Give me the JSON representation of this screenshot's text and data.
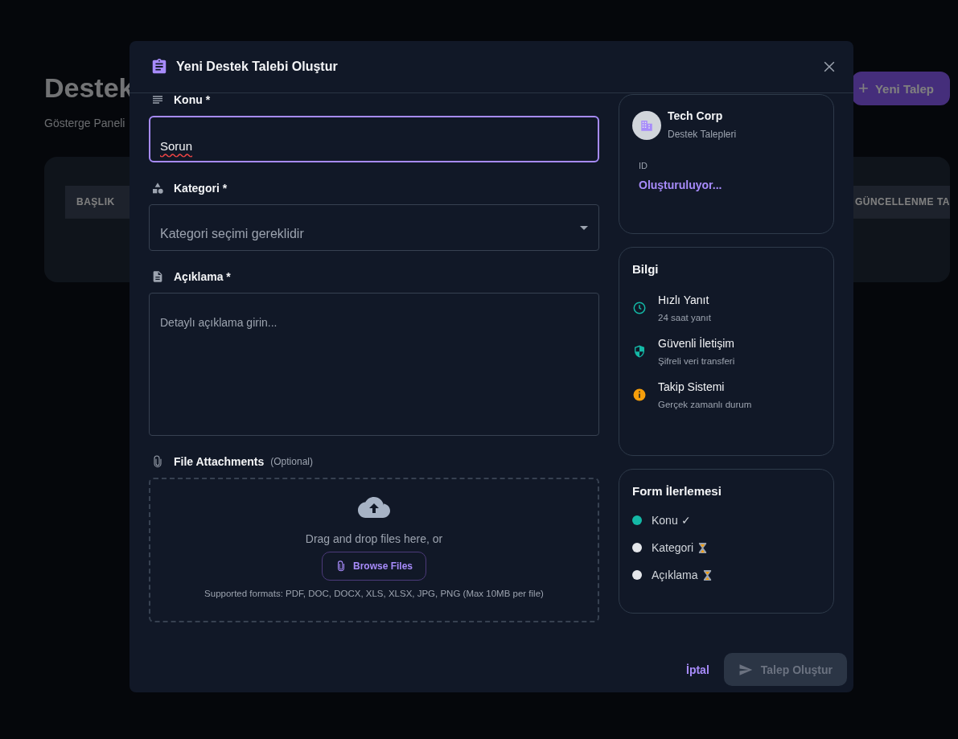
{
  "background": {
    "title": "Destek",
    "subtitle": "Gösterge Paneli",
    "new_button": {
      "icon": "+",
      "label": "Yeni Talep"
    },
    "table": {
      "columns": [
        "BAŞLIK",
        "GÜNCELLENME TA"
      ]
    }
  },
  "dialog": {
    "title": "Yeni Destek Talebi Oluştur",
    "fields": [
      {
        "kind": "text",
        "label": "Konu *",
        "value": "Sorun",
        "focused": true
      },
      {
        "kind": "select",
        "label": "Kategori *",
        "placeholder": "Kategori seçimi gereklidir",
        "focused": false
      },
      {
        "kind": "textarea",
        "label": "Açıklama *",
        "placeholder": "Detaylı açıklama girin...",
        "focused": false
      }
    ],
    "attachments": {
      "label": "File Attachments",
      "note": "(Optional)",
      "drop_text": "Drag and drop files here, or",
      "browse": "Browse Files",
      "formats": "Supported formats: PDF, DOC, DOCX, XLS, XLSX, JPG, PNG (Max 10MB per file)"
    },
    "company": {
      "name": "Tech Corp",
      "subtitle": "Destek Talepleri",
      "id_label": "ID",
      "id_value": "Oluşturuluyor..."
    },
    "info": {
      "title": "Bilgi",
      "items": [
        {
          "kind": "clock",
          "title": "Hızlı Yanıt",
          "text": "24 saat yanıt"
        },
        {
          "kind": "shield",
          "title": "Güvenli İletişim",
          "text": "Şifreli veri transferi"
        },
        {
          "kind": "info",
          "title": "Takip Sistemi",
          "text": "Gerçek zamanlı durum"
        }
      ]
    },
    "progress": {
      "title": "Form İlerlemesi",
      "items": [
        {
          "label": "Konu ✓",
          "done": true
        },
        {
          "label": "Kategori",
          "done": false
        },
        {
          "label": "Açıklama",
          "done": false
        }
      ]
    },
    "actions": {
      "cancel": "İptal",
      "submit": {
        "label": "Talep Oluştur",
        "disabled": true
      }
    }
  }
}
